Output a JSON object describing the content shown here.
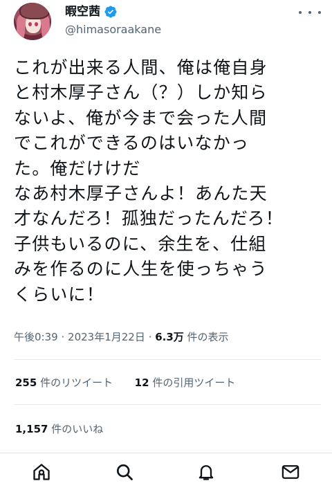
{
  "user": {
    "display_name": "暇空茜",
    "handle": "@himasoraakane",
    "verified": true
  },
  "tweet": {
    "text": "これが出来る人間、俺は俺自身\nと村木厚子さん（？）しか知ら\nないよ、俺が今まで会った人間\nでこれができるのはいなかっ\nた。俺だけけだ\nなあ村木厚子さんよ！あんた天\n才なんだろ！孤独だったんだろ！\n子供もいるのに、余生を、仕組\nみを作るのに人生を使っちゃう\nくらいに！",
    "time": "午後0:39",
    "date": "2023年1月22日",
    "views_count": "6.3万",
    "views_label": "件の表示",
    "dot_separator": "·"
  },
  "stats": {
    "retweets_count": "255",
    "retweets_label": "件のリツイート",
    "quotes_count": "12",
    "quotes_label": "件の引用ツイート",
    "likes_count": "1,157",
    "likes_label": "件のいいね"
  },
  "nav": {
    "icons": [
      "home-icon",
      "search-icon",
      "notifications-icon",
      "messages-icon"
    ]
  },
  "colors": {
    "text_primary": "#0f1419",
    "text_secondary": "#536471",
    "verified_blue": "#1d9bf0",
    "divider": "#e6e9ec"
  }
}
